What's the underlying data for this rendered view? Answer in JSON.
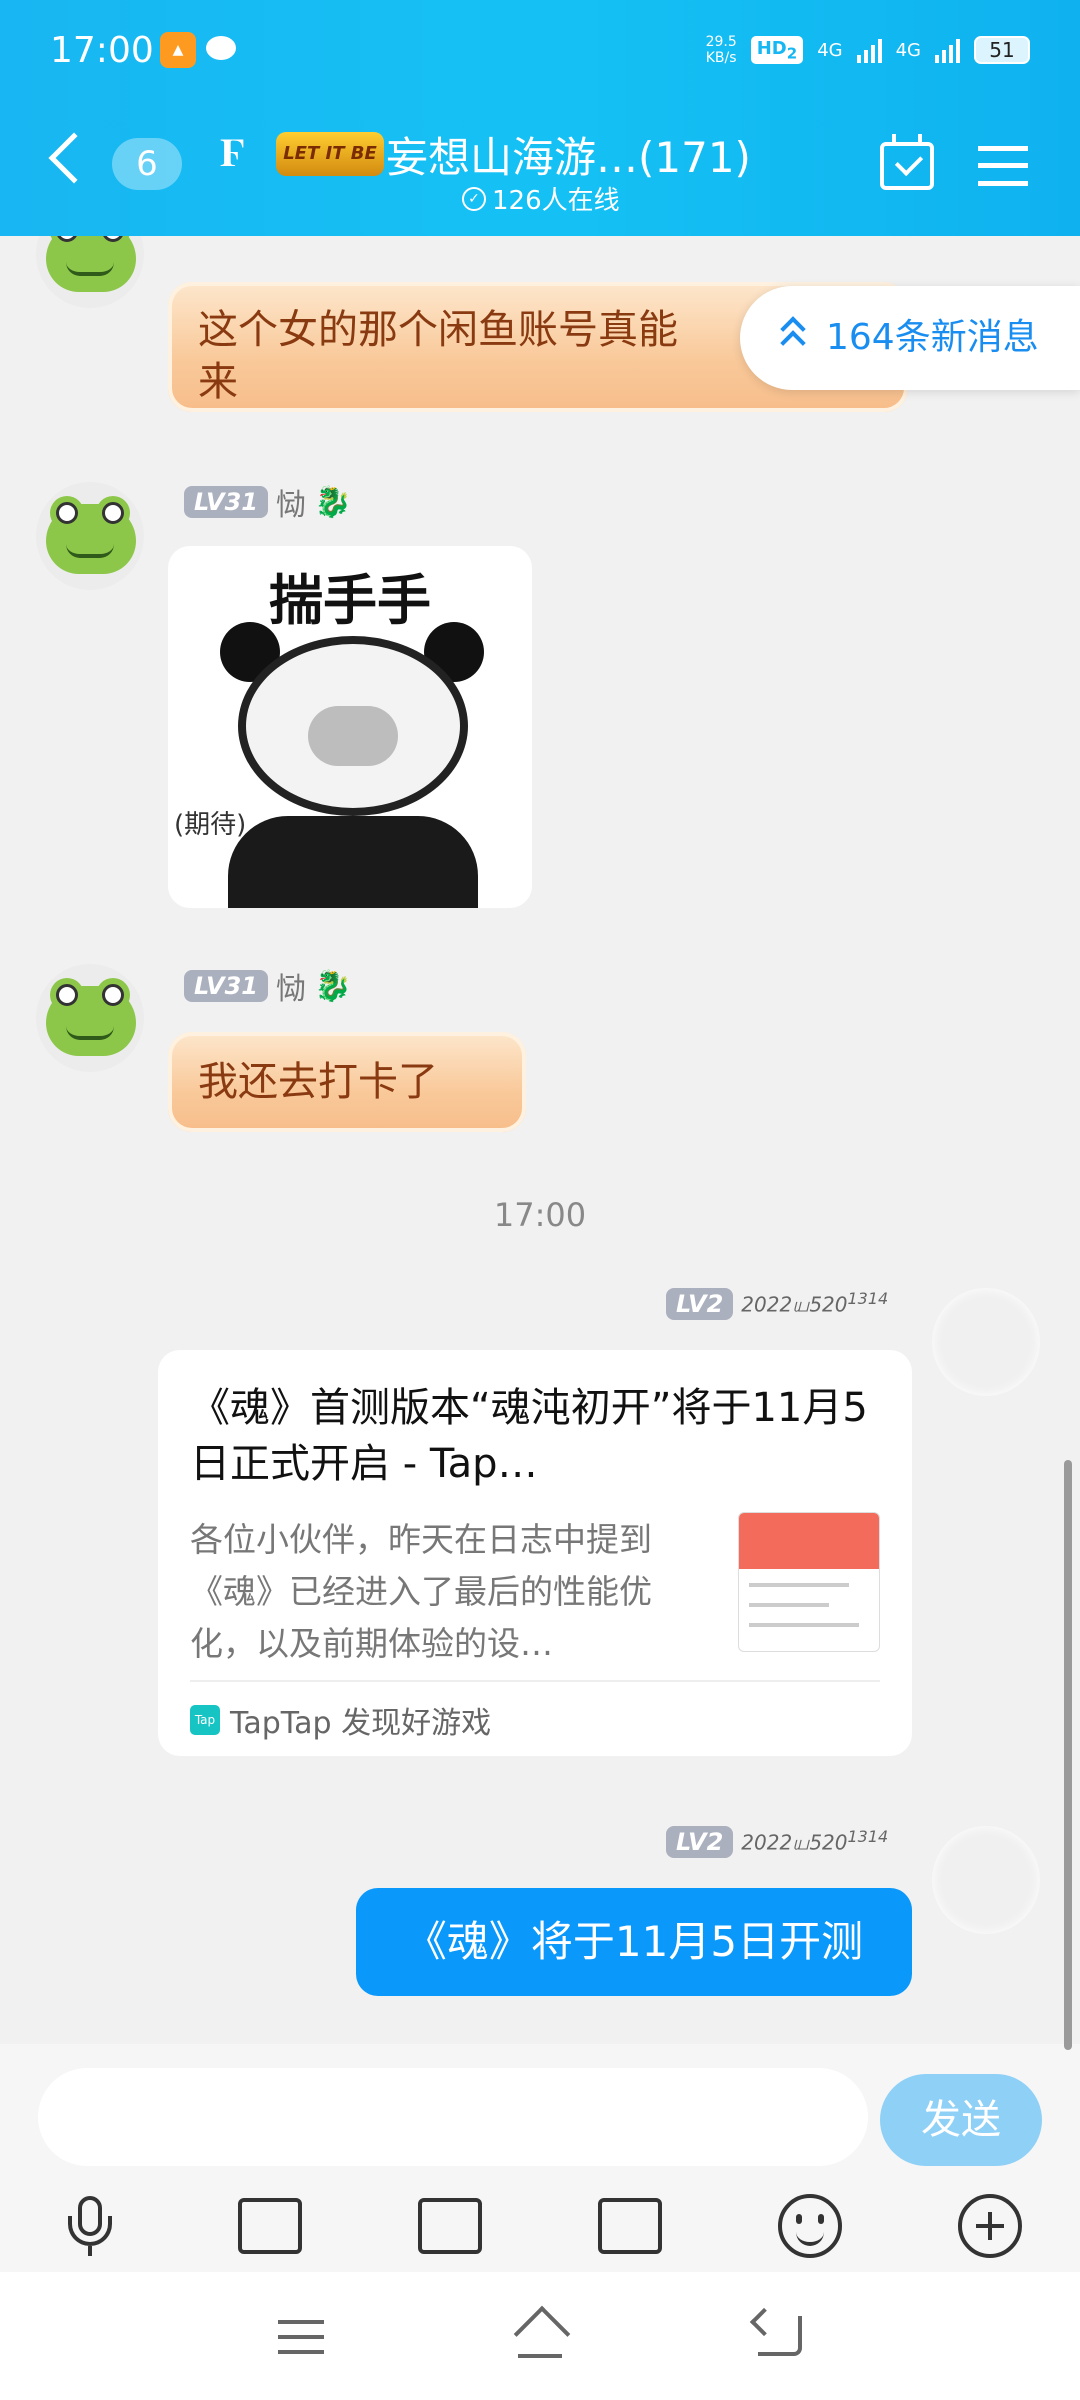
{
  "status_bar": {
    "time": "17:00",
    "net_speed_value": "29.5",
    "net_speed_unit": "KB/s",
    "hd_label": "HD",
    "hd_sub": "2",
    "network_1": "4G",
    "network_2": "4G",
    "battery": "51"
  },
  "header": {
    "unread_count": "6",
    "logo_text": "LET IT BE",
    "group_title": "妄想山海游…(171)",
    "online_text": "126人在线"
  },
  "new_messages": "164条新消息",
  "messages": [
    {
      "level": "LV31",
      "nickname": "恸",
      "text_line1": "这个女的那个闲鱼账号真能",
      "text_line2": "来"
    },
    {
      "level": "LV31",
      "nickname": "恸",
      "sticker_text": "揣手手",
      "sticker_note": "(期待)"
    },
    {
      "level": "LV31",
      "nickname": "恸",
      "text": "我还去打卡了"
    }
  ],
  "time_separator": "17:00",
  "self_meta": {
    "level": "LV2",
    "tag": "2022ய520",
    "tag_sup": "1314"
  },
  "link_card": {
    "title": "《魂》首测版本“魂沌初开”将于11月5日正式开启 - Tap…",
    "description": "各位小伙伴，昨天在日志中提到《魂》已经进入了最后的性能优化，以及前期体验的设…",
    "source_logo": "Tap",
    "source": "TapTap 发现好游戏"
  },
  "self_message": "《魂》将于11月5日开测",
  "input": {
    "placeholder": "",
    "send_label": "发送"
  },
  "colors": {
    "header": "#16b9f3",
    "blue_bubble": "#0a98fb",
    "send_button": "#8fd0f7",
    "link_blue": "#1a8ef0"
  }
}
